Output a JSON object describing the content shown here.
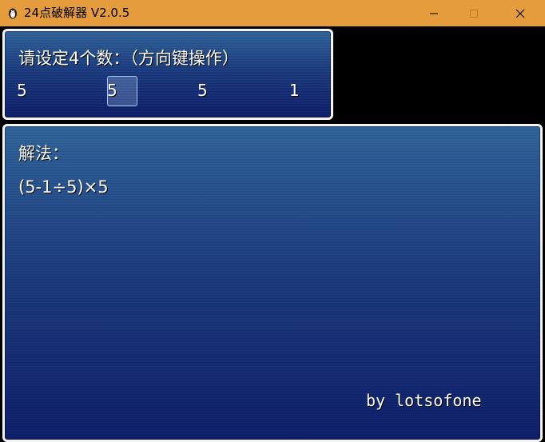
{
  "window": {
    "title": "24点破解器 V2.0.5",
    "app_icon": "penguin-icon",
    "controls": {
      "minimize_icon": "minimize-icon",
      "maximize_icon": "maximize-icon",
      "close_icon": "close-icon"
    },
    "title_bar_color": "#e59c3c"
  },
  "input_panel": {
    "prompt": "请设定4个数：（方向键操作）",
    "numbers": [
      "5",
      "5",
      "5",
      "1"
    ],
    "selected_index": 1
  },
  "solution_panel": {
    "label": "解法：",
    "expression": "(5-1÷5)×5",
    "author": "by lotsofone"
  },
  "colors": {
    "panel_top": "#2c5f95",
    "panel_bottom": "#0a1a66",
    "panel_border": "#f4f4f4",
    "background": "#000000",
    "text": "#ffffff"
  }
}
